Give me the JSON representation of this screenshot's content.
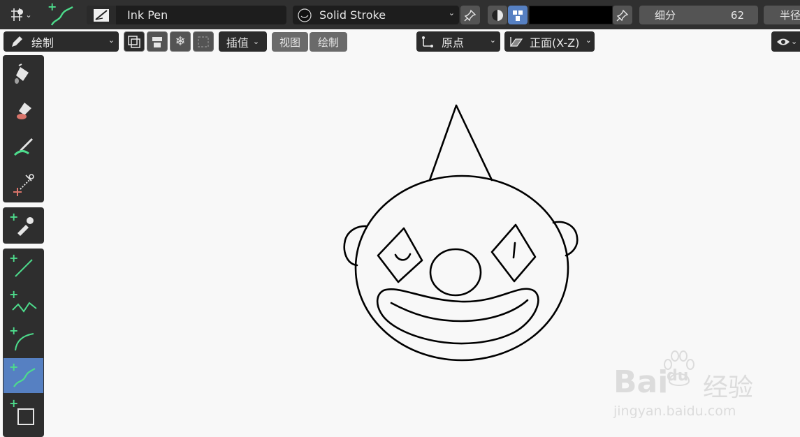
{
  "top_bar": {
    "brush_name": "Ink Pen",
    "material_name": "Solid Stroke",
    "subdivision_label": "细分",
    "subdivision_value": "62",
    "radius_label": "半径",
    "color_swatch": "#000000"
  },
  "header": {
    "mode_label": "绘制",
    "interpolate_label": "插值",
    "view_button": "视图",
    "draw_button": "绘制",
    "origin_label": "原点",
    "orientation_label": "正面(X-Z)"
  },
  "toolbar": {
    "tools": [
      "fill",
      "erase",
      "tint",
      "cutter",
      "eyedropper",
      "line",
      "polyline",
      "arc",
      "curve",
      "box"
    ],
    "active_tool": "curve"
  },
  "watermark": {
    "brand": "Bai",
    "brand2": "du",
    "cn": "经验",
    "url": "jingyan.baidu.com"
  },
  "colors": {
    "panel": "#303030",
    "widget": "#545454",
    "field": "#1d1d1d",
    "accent": "#5680c2",
    "plus_green": "#4ddc8c",
    "canvas": "#f8f8f8"
  }
}
